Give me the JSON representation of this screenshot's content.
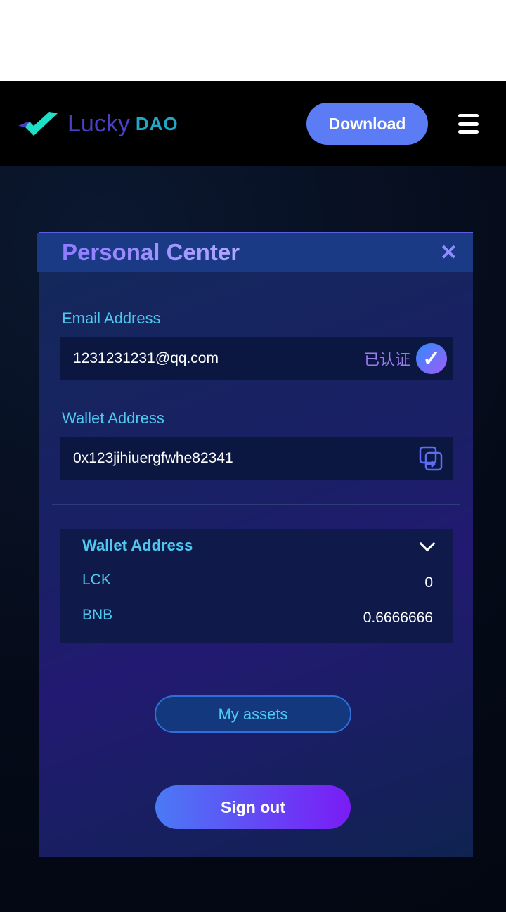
{
  "header": {
    "logo_main": "Lucky",
    "logo_sub": "DAO",
    "download_label": "Download"
  },
  "modal": {
    "title": "Personal Center",
    "email_label": "Email Address",
    "email_value": "1231231231@qq.com",
    "verified_label": "已认证",
    "wallet_label": "Wallet Address",
    "wallet_value": "0x123jihiuergfwhe82341",
    "balances": {
      "title": "Wallet Address",
      "rows": [
        {
          "token": "LCK",
          "amount": "0"
        },
        {
          "token": "BNB",
          "amount": "0.6666666"
        }
      ]
    },
    "assets_label": "My assets",
    "signout_label": "Sign out"
  },
  "colors": {
    "accent": "#5b7cf5",
    "label": "#4ec8ef"
  }
}
